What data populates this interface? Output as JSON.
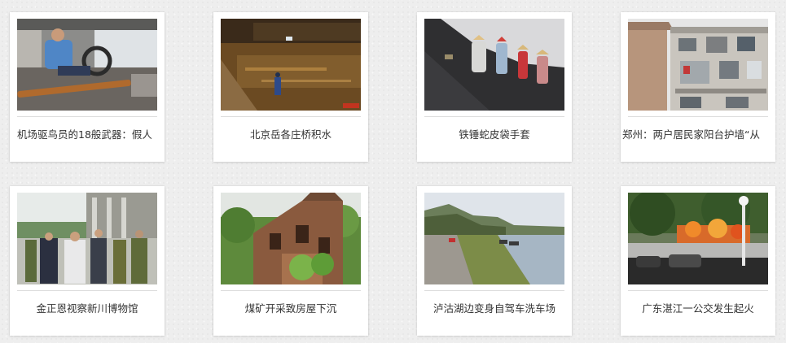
{
  "gallery": {
    "items": [
      {
        "caption": "机场驱鸟员的18般武器：假人",
        "image": "man-driving-car-with-rifle-photo"
      },
      {
        "caption": "北京岳各庄桥积水",
        "image": "flooded-underpass-at-night-photo"
      },
      {
        "caption": "铁锤蛇皮袋手套",
        "image": "workers-on-gravel-slope-photo"
      },
      {
        "caption": "郑州：两户居民家阳台护墙“从",
        "image": "residential-building-balcony-photo"
      },
      {
        "caption": "金正恩视察新川博物馆",
        "image": "officials-visiting-museum-photo"
      },
      {
        "caption": "煤矿开采致房屋下沉",
        "image": "collapsed-brick-house-photo"
      },
      {
        "caption": "泸沽湖边变身自驾车洗车场",
        "image": "lakeside-road-with-cars-photo"
      },
      {
        "caption": "广东湛江一公交发生起火",
        "image": "bus-on-fire-street-photo"
      }
    ]
  }
}
